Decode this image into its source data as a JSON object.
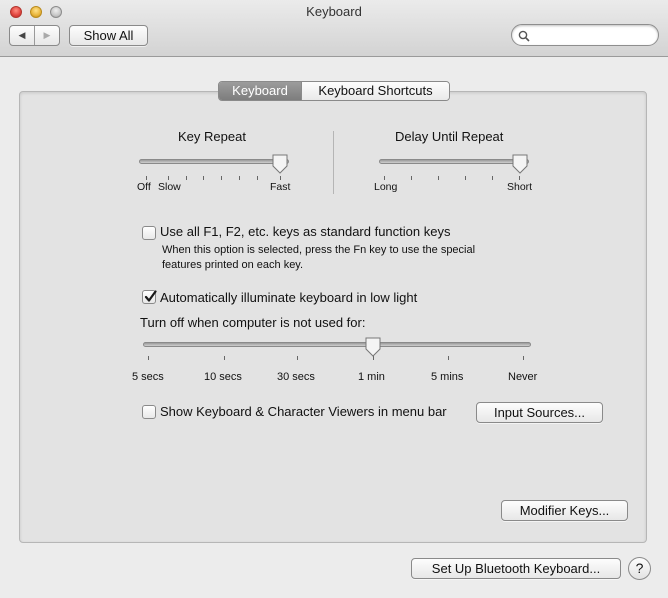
{
  "window": {
    "title": "Keyboard"
  },
  "toolbar": {
    "show_all_label": "Show All",
    "search_value": "",
    "search_placeholder": ""
  },
  "tabs": [
    {
      "label": "Keyboard",
      "selected": true
    },
    {
      "label": "Keyboard Shortcuts",
      "selected": false
    }
  ],
  "key_repeat": {
    "title": "Key Repeat",
    "labels": [
      "Off",
      "Slow",
      "Fast"
    ],
    "value_fraction": 1.0
  },
  "delay_until_repeat": {
    "title": "Delay Until Repeat",
    "labels": [
      "Long",
      "Short"
    ],
    "value_fraction": 1.0
  },
  "function_keys": {
    "label": "Use all F1, F2, etc. keys as standard function keys",
    "note": "When this option is selected, press the Fn key to use the special features printed on each key.",
    "checked": false
  },
  "illuminate": {
    "label": "Automatically illuminate keyboard in low light",
    "checked": true
  },
  "turn_off": {
    "label": "Turn off when computer is not used for:",
    "ticks": [
      "5 secs",
      "10 secs",
      "30 secs",
      "1 min",
      "5 mins",
      "Never"
    ],
    "selected": "1 min"
  },
  "viewers": {
    "label": "Show Keyboard & Character Viewers in menu bar",
    "checked": false
  },
  "buttons": {
    "input_sources": "Input Sources...",
    "modifier_keys": "Modifier Keys...",
    "bluetooth": "Set Up Bluetooth Keyboard...",
    "help": "?"
  }
}
